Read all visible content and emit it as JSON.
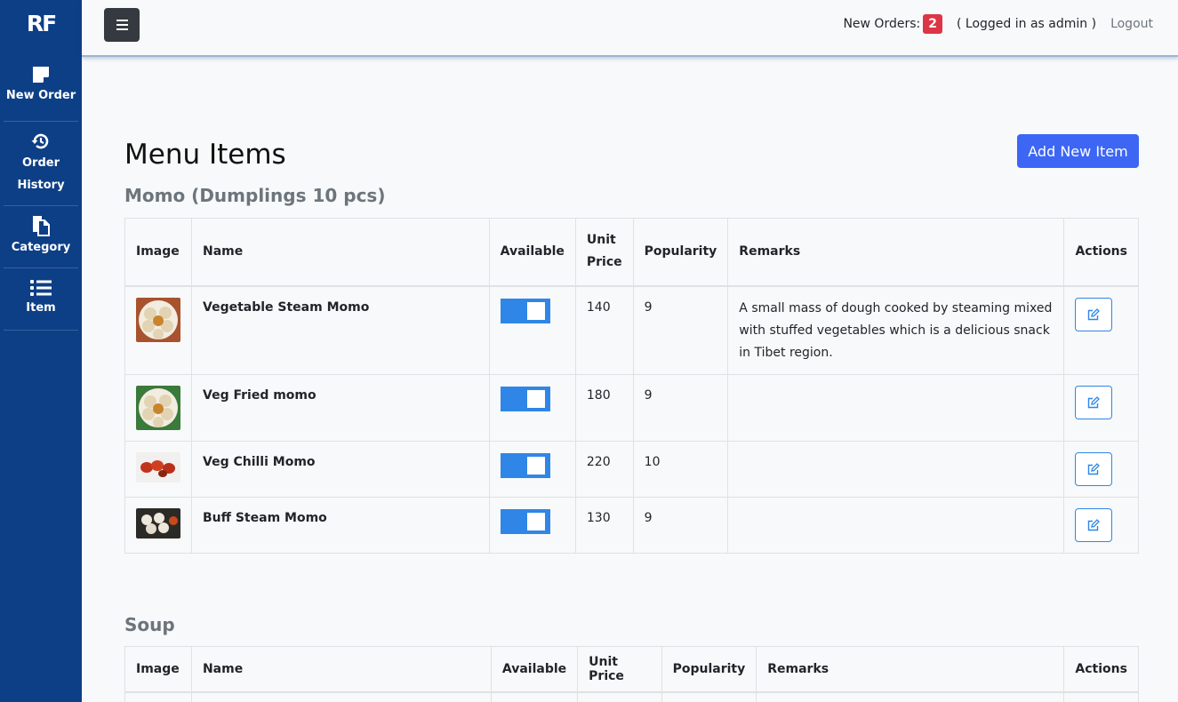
{
  "app": {
    "logo": "RF"
  },
  "sidebar": {
    "items": [
      {
        "label": "New Order",
        "icon": "sticky-note-icon"
      },
      {
        "label": "Order History",
        "icon": "history-icon"
      },
      {
        "label": "Category",
        "icon": "copy-icon"
      },
      {
        "label": "Item",
        "icon": "list-icon"
      }
    ]
  },
  "header": {
    "new_orders_label": "New Orders:",
    "new_orders_count": "2",
    "logged_in_text": "( Logged in as admin )",
    "logout_label": "Logout"
  },
  "page": {
    "title": "Menu Items",
    "add_button": "Add New Item"
  },
  "sections": [
    {
      "title": "Momo (Dumplings 10 pcs)",
      "columns": [
        "Image",
        "Name",
        "Available",
        "Unit Price",
        "Popularity",
        "Remarks",
        "Actions"
      ],
      "rows": [
        {
          "name": "Vegetable Steam Momo",
          "available": true,
          "price": "140",
          "popularity": "9",
          "remarks": "A small mass of dough cooked by steaming mixed with stuffed vegetables which is a delicious snack in Tibet region."
        },
        {
          "name": "Veg Fried momo",
          "available": true,
          "price": "180",
          "popularity": "9",
          "remarks": ""
        },
        {
          "name": "Veg Chilli Momo",
          "available": true,
          "price": "220",
          "popularity": "10",
          "remarks": ""
        },
        {
          "name": "Buff Steam Momo",
          "available": true,
          "price": "130",
          "popularity": "9",
          "remarks": ""
        }
      ]
    },
    {
      "title": "Soup",
      "columns": [
        "Image",
        "Name",
        "Available",
        "Unit Price",
        "Popularity",
        "Remarks",
        "Actions"
      ]
    }
  ],
  "colors": {
    "sidebar": "#0d3f86",
    "primary": "#3d66f5",
    "toggle": "#2f86e6",
    "badge": "#dc3545"
  }
}
